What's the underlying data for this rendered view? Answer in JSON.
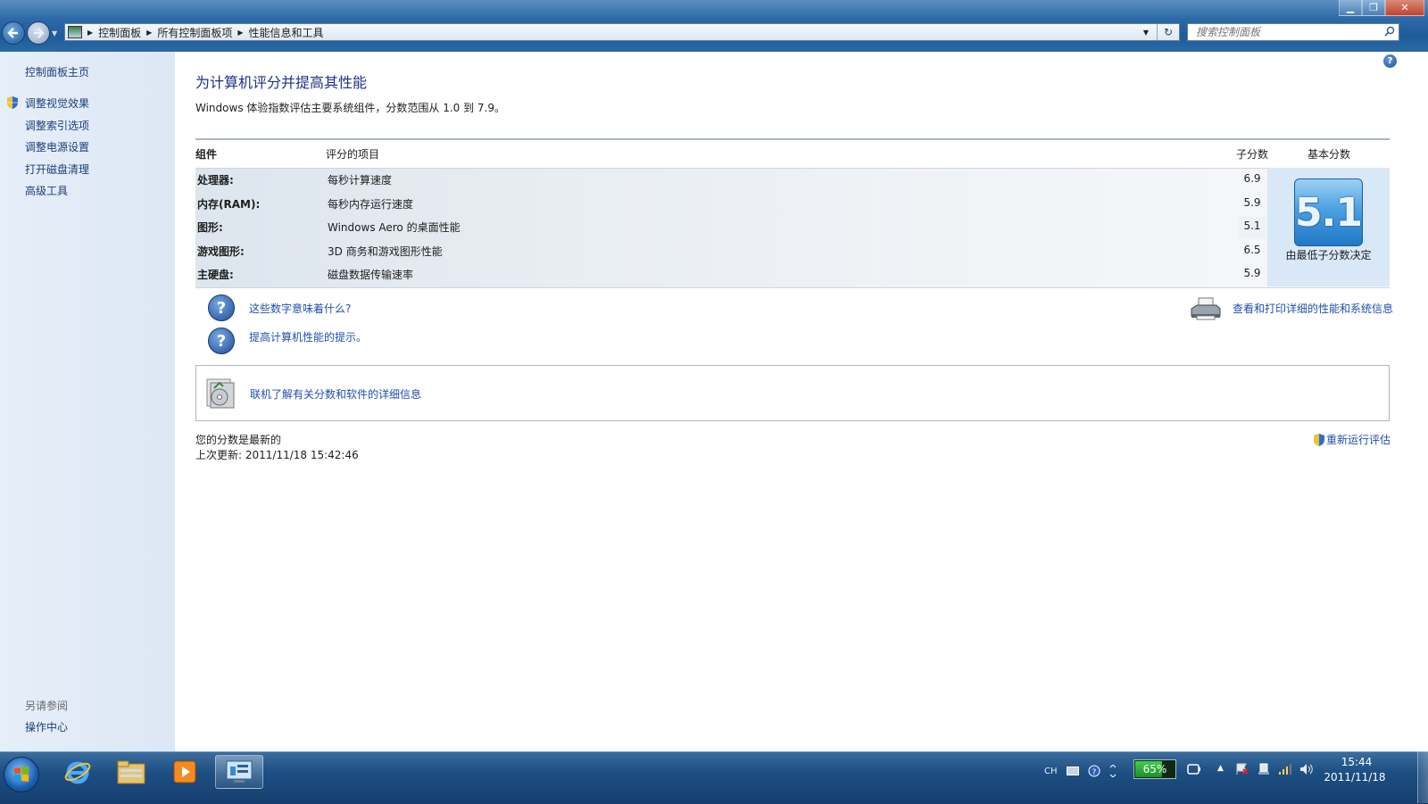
{
  "window": {
    "minimize_glyph": "▁",
    "maximize_glyph": "❐",
    "close_glyph": "✕"
  },
  "address_bar": {
    "breadcrumbs": [
      "控制面板",
      "所有控制面板项",
      "性能信息和工具"
    ],
    "separator_glyph": "▶",
    "dropdown_glyph": "▼",
    "refresh_glyph": "↻"
  },
  "search": {
    "placeholder": "搜索控制面板"
  },
  "sidebar": {
    "home_label": "控制面板主页",
    "items": [
      {
        "label": "调整视觉效果",
        "shield": true
      },
      {
        "label": "调整索引选项"
      },
      {
        "label": "调整电源设置"
      },
      {
        "label": "打开磁盘清理"
      },
      {
        "label": "高级工具"
      }
    ],
    "see_also_header": "另请参阅",
    "see_also_items": [
      {
        "label": "操作中心"
      }
    ]
  },
  "main": {
    "title": "为计算机评分并提高其性能",
    "description": "Windows 体验指数评估主要系统组件，分数范围从 1.0 到 7.9。",
    "table": {
      "headers": [
        "组件",
        "评分的项目",
        "子分数",
        "基本分数"
      ],
      "rows": [
        {
          "component": "处理器:",
          "item": "每秒计算速度",
          "subscore": "6.9"
        },
        {
          "component": "内存(RAM):",
          "item": "每秒内存运行速度",
          "subscore": "5.9"
        },
        {
          "component": "图形:",
          "item": "Windows Aero 的桌面性能",
          "subscore": "5.1"
        },
        {
          "component": "游戏图形:",
          "item": "3D 商务和游戏图形性能",
          "subscore": "6.5"
        },
        {
          "component": "主硬盘:",
          "item": "磁盘数据传输速率",
          "subscore": "5.9"
        }
      ],
      "base_score": "5.1",
      "base_note": "由最低子分数决定"
    },
    "links": {
      "what_numbers_mean": "这些数字意味着什么?",
      "tips": "提高计算机性能的提示。",
      "print_details": "查看和打印详细的性能和系统信息",
      "online_info": "联机了解有关分数和软件的详细信息"
    },
    "status": "您的分数是最新的",
    "last_updated": "上次更新: 2011/11/18 15:42:46",
    "rerun": "重新运行评估"
  },
  "taskbar": {
    "tray": {
      "lang": "CH",
      "battery_percent": "65%",
      "battery_level": 0.65
    },
    "clock_time": "15:44",
    "clock_date": "2011/11/18"
  },
  "colors": {
    "accent_title": "#1e3287",
    "link": "#1f4faa",
    "taskbar": "#1d4e82",
    "score_tile": "#4aa1e2"
  },
  "icons": {
    "help": "help-icon",
    "question": "question-icon",
    "printer": "printer-icon",
    "shield": "uac-shield-icon",
    "search": "search-icon"
  }
}
